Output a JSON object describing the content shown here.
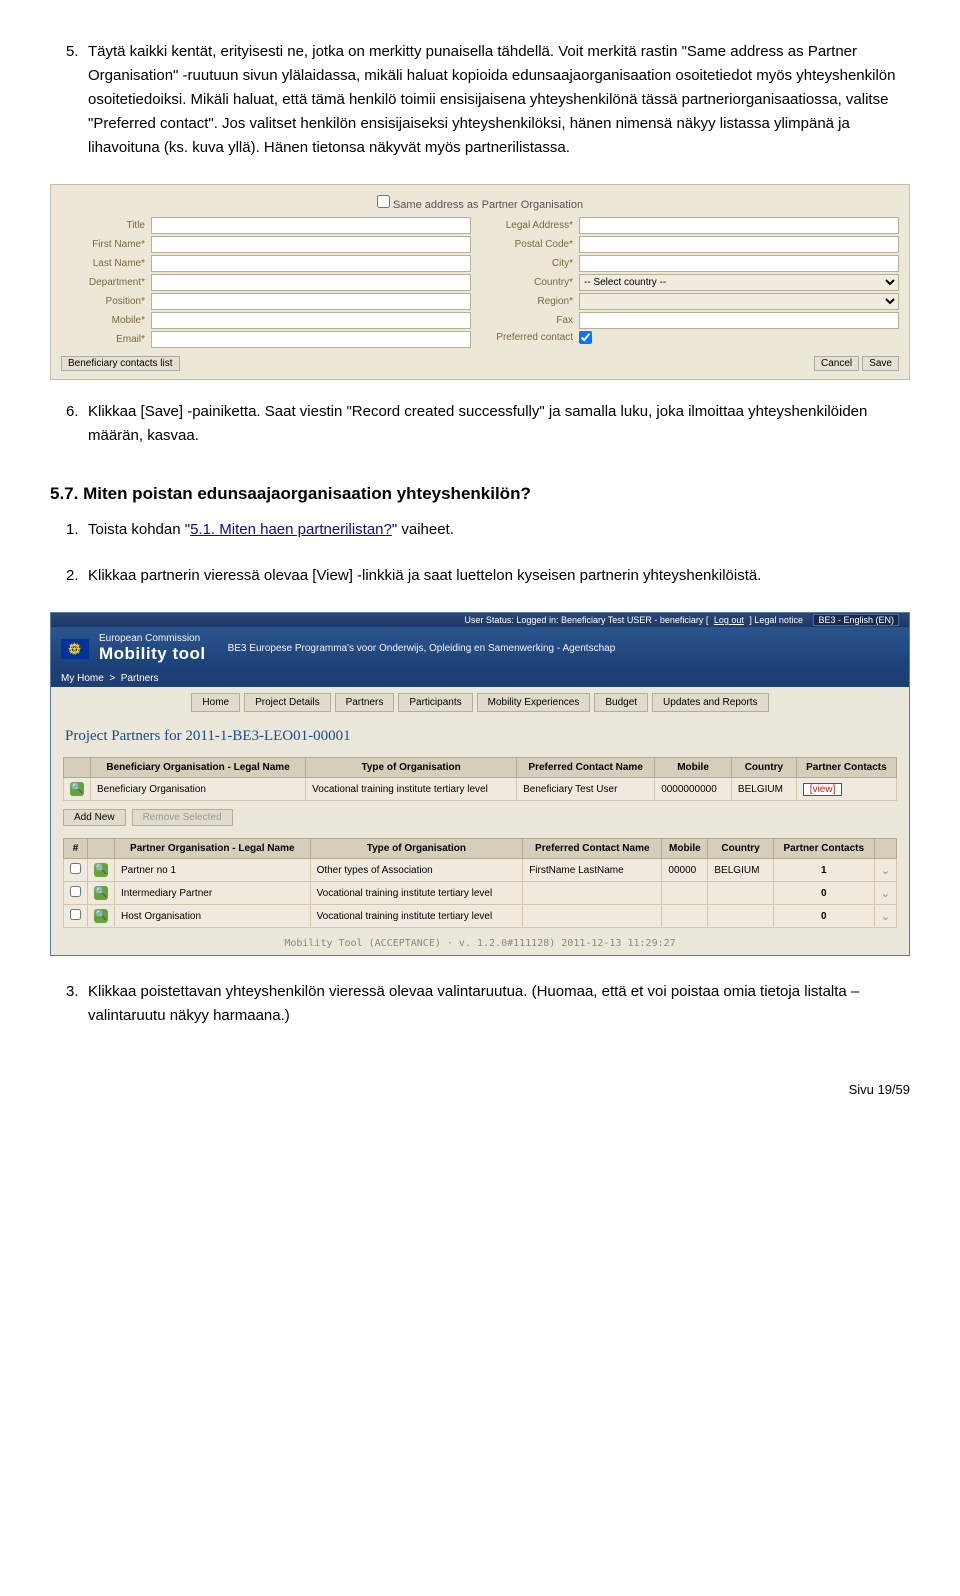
{
  "step5": {
    "num": "5.",
    "text": "Täytä kaikki kentät, erityisesti ne, jotka on merkitty punaisella tähdellä. Voit merkitä rastin \"Same address as Partner Organisation\" -ruutuun sivun ylälaidassa, mikäli haluat kopioida edunsaajaorganisaation osoitetiedot myös yhteyshenkilön osoitetiedoiksi. Mikäli haluat, että tämä henkilö toimii ensisijaisena yhteyshenkilönä tässä partneriorganisaatiossa, valitse \"Preferred contact\". Jos valitset henkilön ensisijaiseksi yhteyshenkilöksi, hänen nimensä näkyy listassa ylimpänä ja lihavoituna (ks. kuva yllä). Hänen tietonsa näkyvät myös partnerilistassa."
  },
  "form": {
    "sameAddress": "Same address as Partner Organisation",
    "left": {
      "title": "Title",
      "firstName": "First Name*",
      "lastName": "Last Name*",
      "department": "Department*",
      "position": "Position*",
      "mobile": "Mobile*",
      "email": "Email*"
    },
    "right": {
      "legal": "Legal Address*",
      "postal": "Postal Code*",
      "city": "City*",
      "country": "Country*",
      "countryPlaceholder": "-- Select country --",
      "region": "Region*",
      "fax": "Fax",
      "preferred": "Preferred contact"
    },
    "footerLeft": "Beneficiary contacts list",
    "cancel": "Cancel",
    "save": "Save"
  },
  "step6": {
    "num": "6.",
    "text": "Klikkaa [Save] -painiketta. Saat viestin \"Record created successfully\" ja samalla luku, joka ilmoittaa yhteyshenkilöiden määrän, kasvaa."
  },
  "h57": "5.7. Miten poistan edunsaajaorganisaation yhteyshenkilön?",
  "s57_1": {
    "num": "1.",
    "pre": "Toista kohdan \"",
    "link": "5.1. Miten haen partnerilistan?",
    "post": "\" vaiheet."
  },
  "s57_2": {
    "num": "2.",
    "text": "Klikkaa partnerin vieressä olevaa [View] -linkkiä ja saat luettelon kyseisen partnerin yhteyshenkilöistä."
  },
  "app": {
    "userStatus": "User Status: Logged in: Beneficiary Test USER - beneficiary [",
    "logout": "Log out",
    "legal": "] Legal notice",
    "lang": "BE3 - English (EN)",
    "ec": "European Commission",
    "mt": "Mobility tool",
    "sub": "BE3 Europese Programma's voor Onderwijs, Opleiding en Samenwerking - Agentschap",
    "crumb1": "My Home",
    "crumb2": "Partners",
    "tabs": [
      "Home",
      "Project Details",
      "Partners",
      "Participants",
      "Mobility Experiences",
      "Budget",
      "Updates and Reports"
    ],
    "projectTitle": "Project Partners for 2011-1-BE3-LEO01-00001",
    "t1headers": [
      "Beneficiary Organisation - Legal Name",
      "Type of Organisation",
      "Preferred Contact Name",
      "Mobile",
      "Country",
      "Partner Contacts"
    ],
    "t1row": [
      "Beneficiary Organisation",
      "Vocational training institute tertiary level",
      "Beneficiary Test User",
      "0000000000",
      "BELGIUM",
      "[view]"
    ],
    "addNew": "Add New",
    "removeSel": "Remove Selected",
    "t2headers": [
      "#",
      "Partner Organisation - Legal Name",
      "Type of Organisation",
      "Preferred Contact Name",
      "Mobile",
      "Country",
      "Partner Contacts"
    ],
    "t2rows": [
      [
        "",
        "Partner no 1",
        "Other types of Association",
        "FirstName LastName",
        "00000",
        "BELGIUM",
        "1"
      ],
      [
        "",
        "Intermediary Partner",
        "Vocational training institute tertiary level",
        "",
        "",
        "",
        "0"
      ],
      [
        "",
        "Host Organisation",
        "Vocational training institute tertiary level",
        "",
        "",
        "",
        "0"
      ]
    ],
    "foot": "Mobility Tool (ACCEPTANCE) · v. 1.2.0#111128) 2011-12-13 11:29:27"
  },
  "step3": {
    "num": "3.",
    "text": "Klikkaa poistettavan yhteyshenkilön vieressä olevaa valintaruutua. (Huomaa, että et voi poistaa omia tietoja listalta – valintaruutu näkyy harmaana.)"
  },
  "pageFooter": "Sivu 19/59"
}
